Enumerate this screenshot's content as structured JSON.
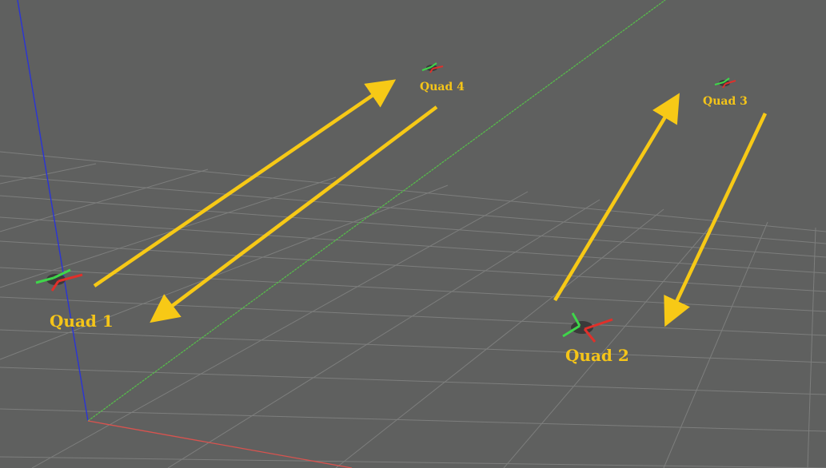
{
  "scene": {
    "background_color": "#5f605f",
    "grid_color": "#8c8d8c",
    "axes": {
      "x_color": "#d9534f",
      "y_color": "#56c04a",
      "z_color": "#2a34d6"
    },
    "arrow_color": "#f7c916",
    "label_color": "#f5c518"
  },
  "quads": [
    {
      "label": "Quad 1"
    },
    {
      "label": "Quad 2"
    },
    {
      "label": "Quad 3"
    },
    {
      "label": "Quad 4"
    }
  ],
  "quadrotor_colors": {
    "body": "#3a3a3a",
    "green_arms": "#3fd64a",
    "red_arms": "#e0302a"
  }
}
